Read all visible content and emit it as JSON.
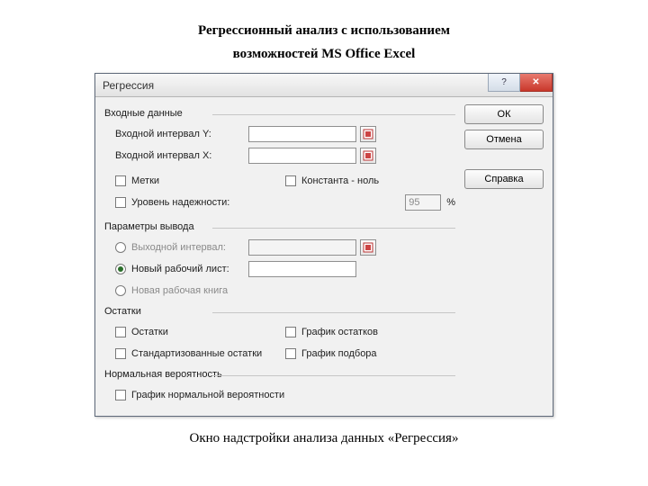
{
  "page": {
    "title_line1": "Регрессионный анализ с использованием",
    "title_line2": "возможностей MS Office Excel",
    "caption": "Окно надстройки анализа данных «Регрессия»"
  },
  "dialog": {
    "title": "Регрессия",
    "buttons": {
      "ok": "ОК",
      "cancel": "Отмена",
      "help": "Справка"
    },
    "groups": {
      "input": {
        "header": "Входные данные",
        "y_label": "Входной интервал Y:",
        "x_label": "Входной интервал X:",
        "y_value": "",
        "x_value": "",
        "labels": "Метки",
        "const_zero": "Константа - ноль",
        "confidence": "Уровень надежности:",
        "confidence_value": "95",
        "percent": "%"
      },
      "output": {
        "header": "Параметры вывода",
        "range": "Выходной интервал:",
        "range_value": "",
        "new_sheet": "Новый рабочий лист:",
        "new_sheet_value": "",
        "new_book": "Новая рабочая книга"
      },
      "residuals": {
        "header": "Остатки",
        "resid": "Остатки",
        "std_resid": "Стандартизованные остатки",
        "resid_plot": "График остатков",
        "fit_plot": "График подбора"
      },
      "normal": {
        "header": "Нормальная вероятность",
        "normal_plot": "График нормальной вероятности"
      }
    }
  }
}
